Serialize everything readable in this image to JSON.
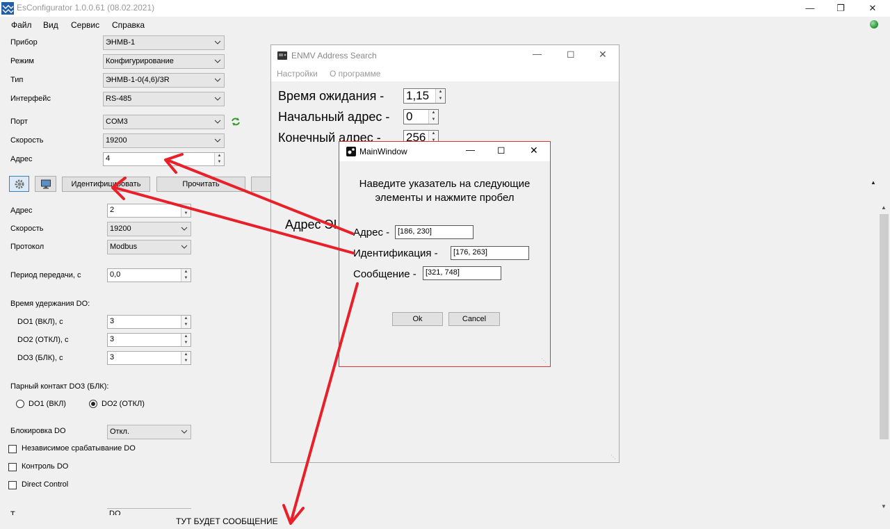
{
  "app": {
    "title": "EsConfigurator 1.0.0.61 (08.02.2021)",
    "menu": [
      "Файл",
      "Вид",
      "Сервис",
      "Справка"
    ]
  },
  "device": {
    "device_label": "Прибор",
    "device_value": "ЭНМВ-1",
    "mode_label": "Режим",
    "mode_value": "Конфигурирование",
    "type_label": "Тип",
    "type_value": "ЭНМВ-1-0(4,6)/3R",
    "interface_label": "Интерфейс",
    "interface_value": "RS-485",
    "port_label": "Порт",
    "port_value": "COM3",
    "speed_label": "Скорость",
    "speed_value": "19200",
    "address_label": "Адрес",
    "address_value": "4"
  },
  "toolbar": {
    "identify_label": "Идентифицировать",
    "read_label": "Прочитать"
  },
  "params": {
    "address_label": "Адрес",
    "address_value": "2",
    "speed_label": "Скорость",
    "speed_value": "19200",
    "protocol_label": "Протокол",
    "protocol_value": "Modbus",
    "period_label": "Период передачи, с",
    "period_value": "0,0",
    "hold_title": "Время удержания DO:",
    "do1_label": "DO1 (ВКЛ), с",
    "do1_value": "3",
    "do2_label": "DO2 (ОТКЛ), с",
    "do2_value": "3",
    "do3_label": "DO3 (БЛК), с",
    "do3_value": "3",
    "pair_title": "Парный контакт DO3 (БЛК):",
    "radio1_label": "DO1 (ВКЛ)",
    "radio2_label": "DO2 (ОТКЛ)",
    "block_label": "Блокировка DO",
    "block_value": "Откл.",
    "chk1_label": "Независимое срабатывание DO",
    "chk2_label": "Контроль DO",
    "chk3_label": "Direct Control",
    "cut_label": "Т",
    "cut_value": "DO"
  },
  "status_message": "ТУТ БУДЕТ СООБЩЕНИЕ",
  "enmv": {
    "title": "ENMV Address Search",
    "menu": [
      "Настройки",
      "О программе"
    ],
    "wait_label": "Время ожидания -",
    "wait_value": "1,15",
    "start_label": "Начальный адрес -",
    "start_value": "0",
    "end_label": "Конечный адрес -",
    "end_value": "256",
    "addr_label": "Адрес ЭІ"
  },
  "dialog": {
    "title": "MainWindow",
    "instruction_line1": "Наведите указатель на следующие",
    "instruction_line2": "элементы и нажмите пробел",
    "address_label": "Адрес -",
    "address_value": "[186, 230]",
    "identify_label": "Идентификация -",
    "identify_value": "[176, 263]",
    "message_label": "Сообщение -",
    "message_value": "[321, 748]",
    "ok_label": "Ok",
    "cancel_label": "Cancel"
  },
  "colors": {
    "annotation_arrow": "#e8202a",
    "dialog_border": "#dd3333",
    "status_globe": "#2e9e3e"
  }
}
